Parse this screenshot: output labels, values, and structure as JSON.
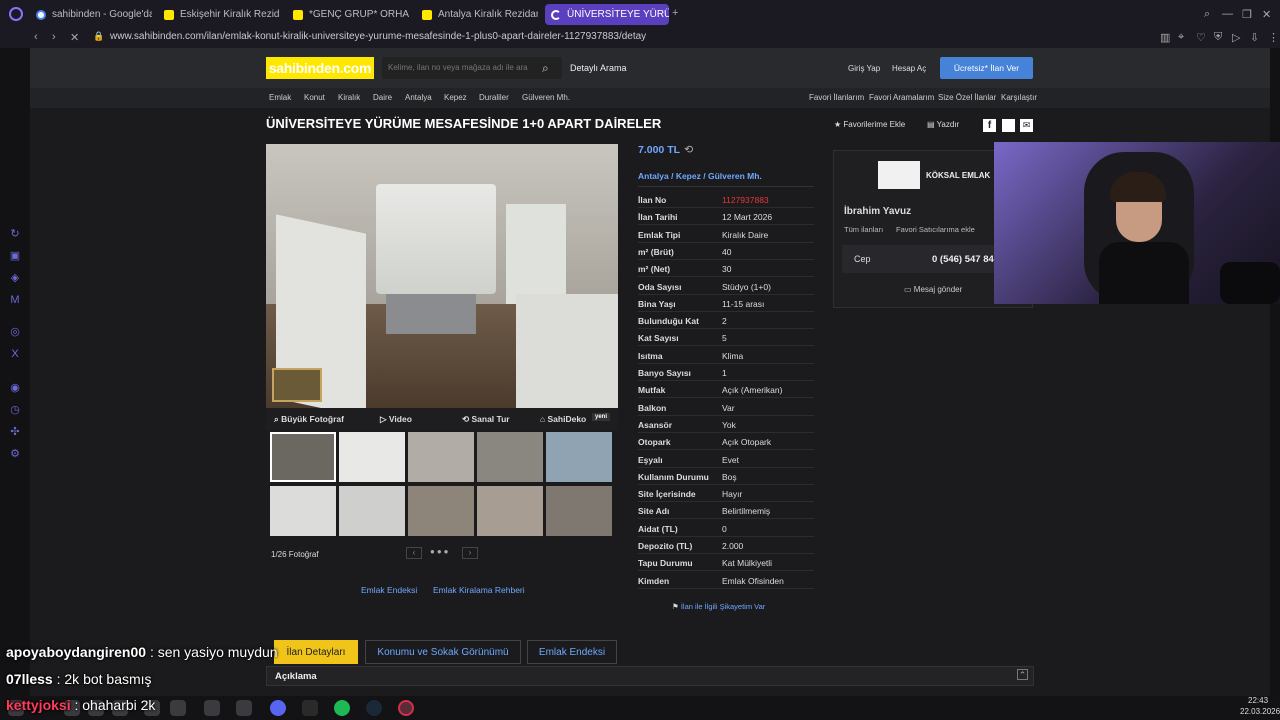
{
  "browser": {
    "tabs": [
      {
        "label": "sahibinden - Google'da Ara",
        "fav": "g"
      },
      {
        "label": "Eskişehir Kiralık Rezidans,",
        "fav": "s"
      },
      {
        "label": "*GENÇ GRUP* ORHANGA",
        "fav": "s"
      },
      {
        "label": "Antalya Kiralık Rezidans, V",
        "fav": "s"
      },
      {
        "label": "ÜNİVERSİTEYE YÜRÜ",
        "fav": "spin"
      }
    ],
    "url": "www.sahibinden.com/ilan/emlak-konut-kiralik-universiteye-yurume-mesafesinde-1-plus0-apart-daireler-1127937883/detay"
  },
  "site": {
    "logo": "sahibinden.com",
    "search_placeholder": "Kelime, ilan no veya mağaza adı ile ara",
    "detailed_search": "Detaylı Arama",
    "login": "Giriş Yap",
    "signup": "Hesap Aç",
    "post_ad": "Ücretsiz* İlan Ver",
    "breadcrumbs": [
      "Emlak",
      "Konut",
      "Kiralık",
      "Daire",
      "Antalya",
      "Kepez",
      "Duraliler",
      "Gülveren Mh."
    ],
    "right_links": [
      "Favori İlanlarım",
      "Favori Aramalarım",
      "Size Özel İlanlar",
      "Karşılaştır"
    ]
  },
  "listing": {
    "title": "ÜNİVERSİTEYE YÜRÜME MESAFESİNDE 1+0 APART DAİRELER",
    "fav_add": "Favorilerime Ekle",
    "print": "Yazdır",
    "price": "7.000 TL",
    "location": [
      "Antalya",
      "Kepez",
      "Gülveren Mh."
    ],
    "media_tabs": [
      "Büyük Fotoğraf",
      "Video",
      "Sanal Tur",
      "SahiDeko"
    ],
    "new_badge": "yeni",
    "photo_counter": "1/26 Fotoğraf",
    "details": [
      {
        "k": "İlan No",
        "v": "1127937883",
        "red": true
      },
      {
        "k": "İlan Tarihi",
        "v": "12 Mart 2026"
      },
      {
        "k": "Emlak Tipi",
        "v": "Kiralık Daire"
      },
      {
        "k": "m² (Brüt)",
        "v": "40"
      },
      {
        "k": "m² (Net)",
        "v": "30"
      },
      {
        "k": "Oda Sayısı",
        "v": "Stüdyo (1+0)"
      },
      {
        "k": "Bina Yaşı",
        "v": "11-15 arası"
      },
      {
        "k": "Bulunduğu Kat",
        "v": "2"
      },
      {
        "k": "Kat Sayısı",
        "v": "5"
      },
      {
        "k": "Isıtma",
        "v": "Klima"
      },
      {
        "k": "Banyo Sayısı",
        "v": "1"
      },
      {
        "k": "Mutfak",
        "v": "Açık (Amerikan)"
      },
      {
        "k": "Balkon",
        "v": "Var"
      },
      {
        "k": "Asansör",
        "v": "Yok"
      },
      {
        "k": "Otopark",
        "v": "Açık Otopark"
      },
      {
        "k": "Eşyalı",
        "v": "Evet"
      },
      {
        "k": "Kullanım Durumu",
        "v": "Boş"
      },
      {
        "k": "Site İçerisinde",
        "v": "Hayır"
      },
      {
        "k": "Site Adı",
        "v": "Belirtilmemiş"
      },
      {
        "k": "Aidat (TL)",
        "v": "0"
      },
      {
        "k": "Depozito (TL)",
        "v": "2.000"
      },
      {
        "k": "Tapu Durumu",
        "v": "Kat Mülkiyetli"
      },
      {
        "k": "Kimden",
        "v": "Emlak Ofisinden"
      }
    ],
    "complaint": "İlan ile İlgili Şikayetim Var",
    "links": [
      "Emlak Endeksi",
      "Emlak Kiralama Rehberi"
    ],
    "bottom_tabs": [
      "İlan Detayları",
      "Konumu ve Sokak Görünümü",
      "Emlak Endeksi"
    ],
    "description": "Açıklama"
  },
  "seller": {
    "agency": "KÖKSAL EMLAK",
    "name": "İbrahim Yavuz",
    "all_ads": "Tüm ilanları",
    "fav_seller": "Favori Satıcılarıma ekle",
    "phone_label": "Cep",
    "phone": "0 (546) 547 84",
    "message": "Mesaj gönder"
  },
  "overlay_chat": [
    {
      "user": "apoyaboydangiren00",
      "msg": ": sen yasiyo muydun"
    },
    {
      "user": "07lless",
      "msg": ": 2k bot basmış"
    },
    {
      "user": "kettyjoksi",
      "msg": ": ohaharbi 2k"
    }
  ],
  "clock": {
    "time": "22:43",
    "date": "22.03.2026"
  }
}
